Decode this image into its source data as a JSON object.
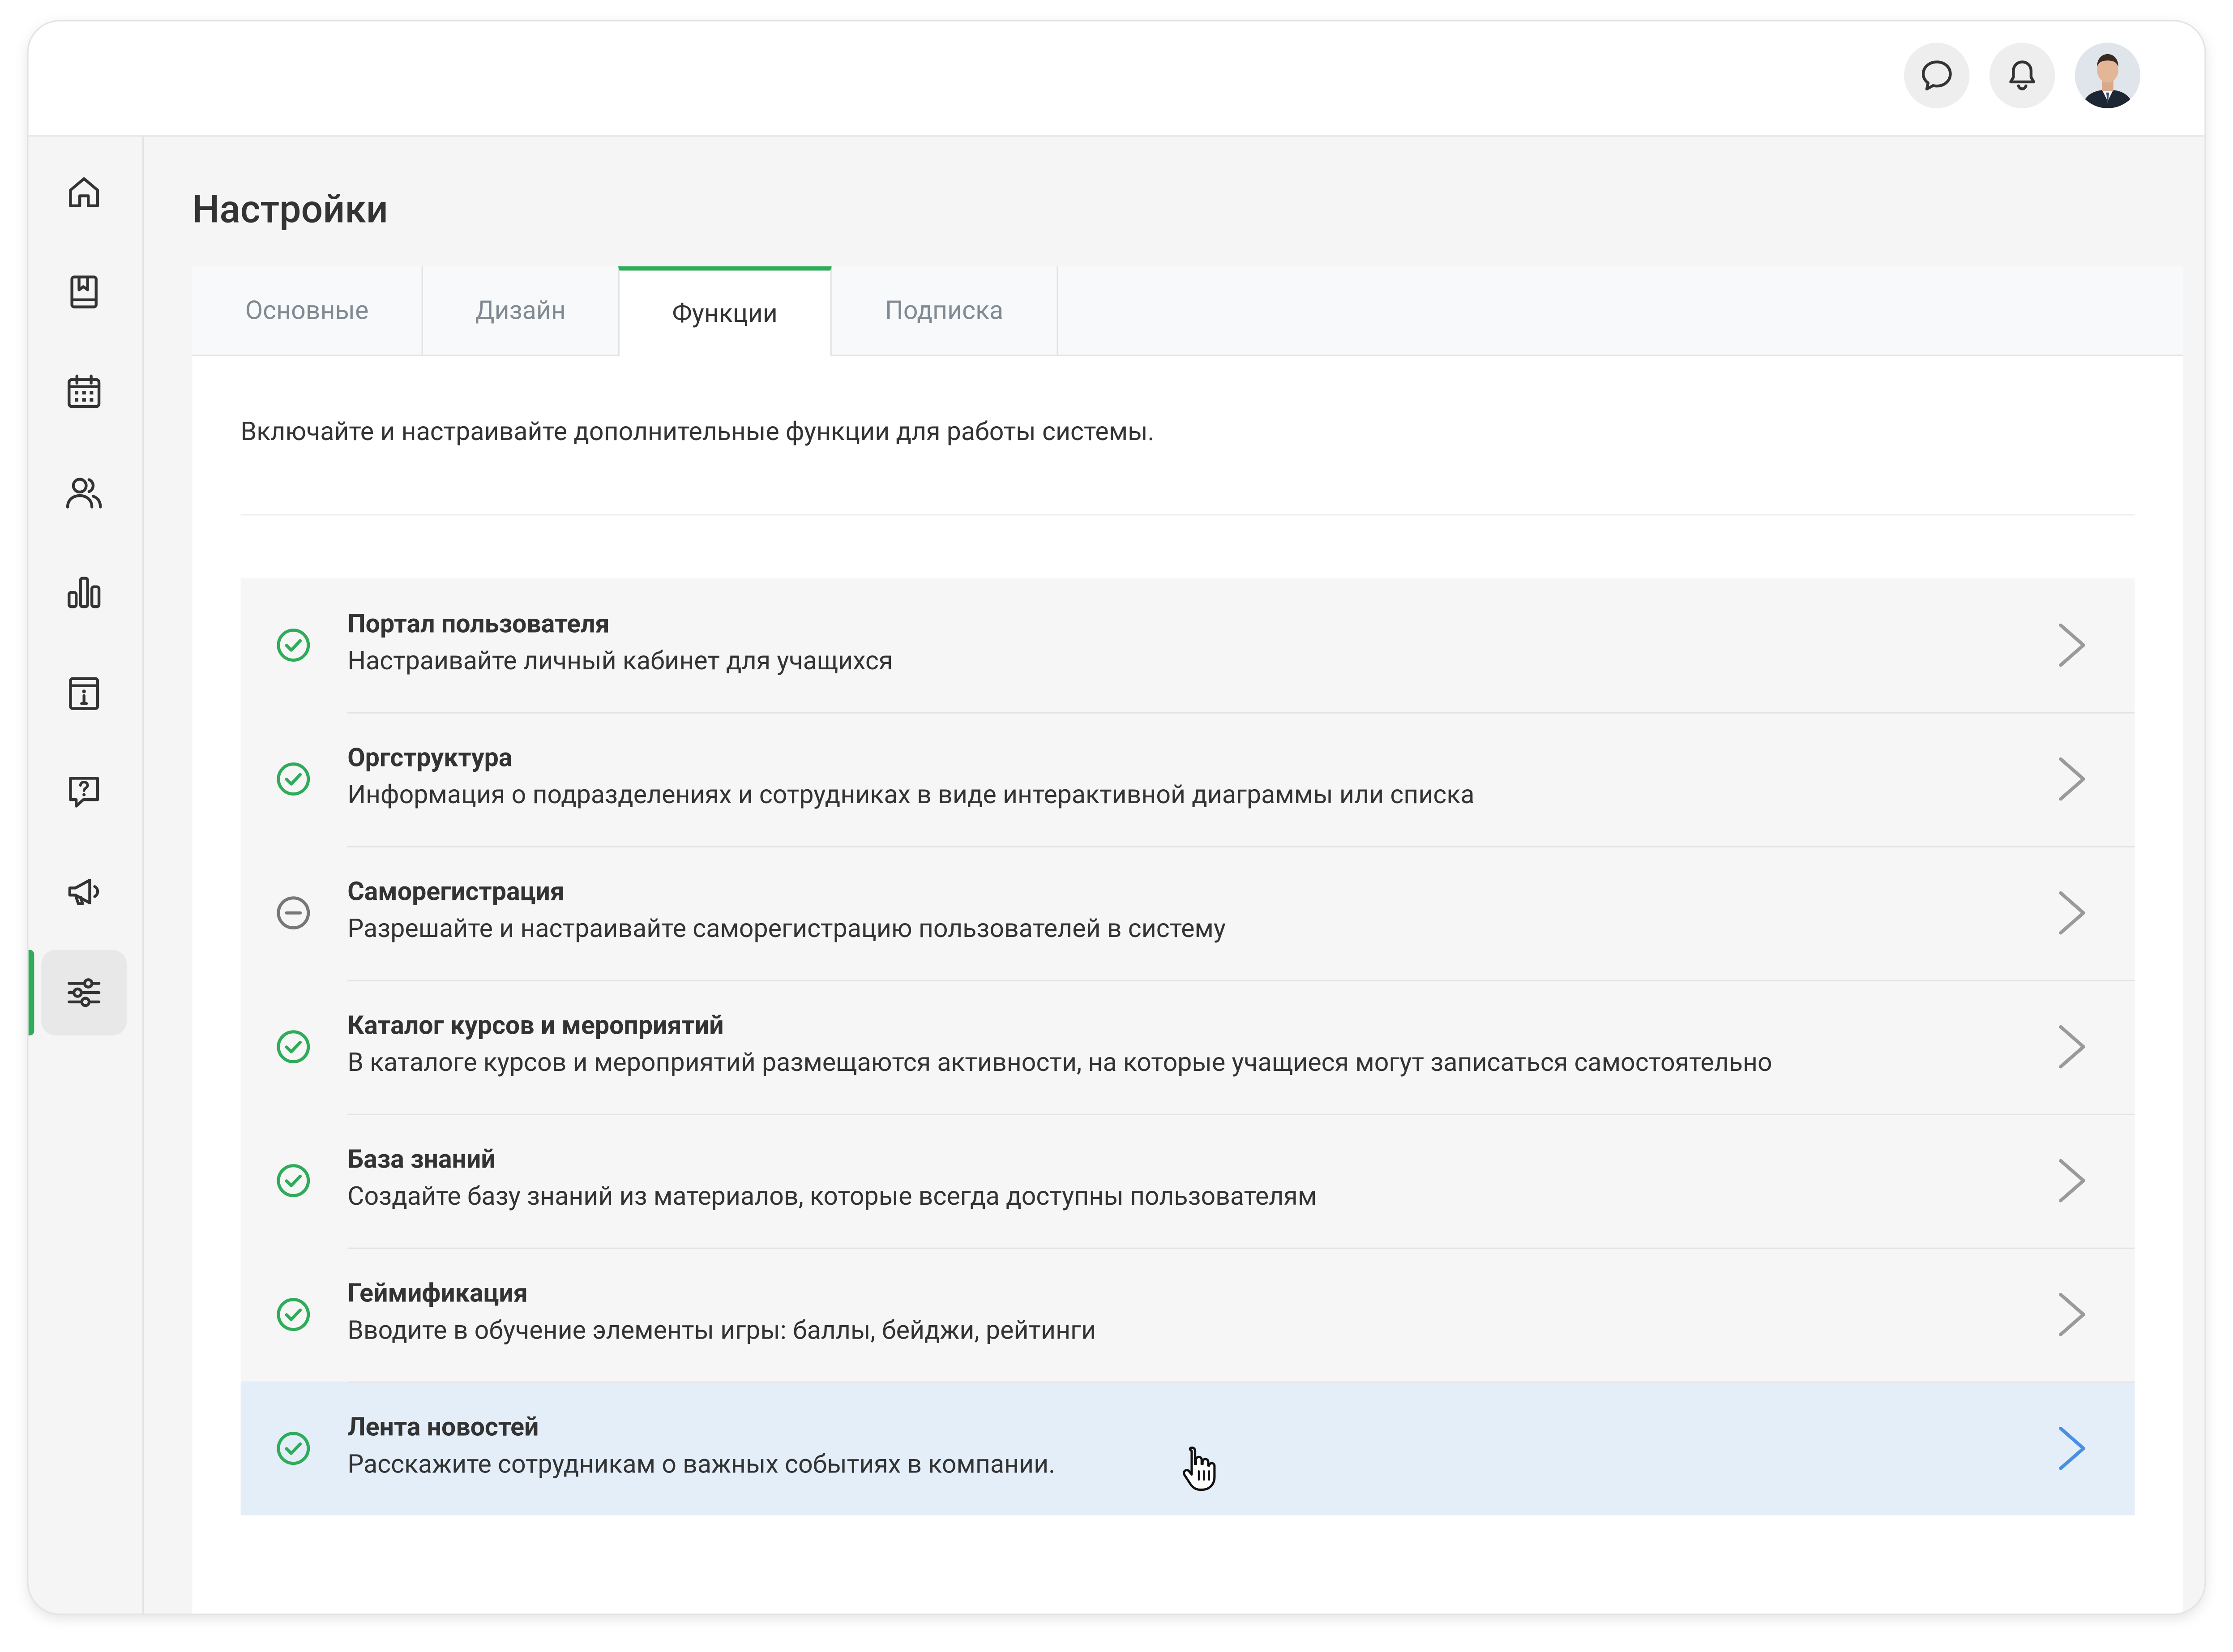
{
  "page": {
    "title": "Настройки",
    "intro": "Включайте и настраивайте дополнительные функции для работы системы."
  },
  "tabs": [
    {
      "label": "Основные",
      "active": false
    },
    {
      "label": "Дизайн",
      "active": false
    },
    {
      "label": "Функции",
      "active": true
    },
    {
      "label": "Подписка",
      "active": false
    }
  ],
  "header": {
    "icons": [
      "chat-icon",
      "bell-icon",
      "avatar"
    ]
  },
  "sidebar": {
    "items": [
      {
        "icon": "home-icon"
      },
      {
        "icon": "book-icon"
      },
      {
        "icon": "calendar-icon"
      },
      {
        "icon": "users-icon"
      },
      {
        "icon": "bar-chart-icon"
      },
      {
        "icon": "info-board-icon"
      },
      {
        "icon": "question-chat-icon"
      },
      {
        "icon": "megaphone-icon"
      },
      {
        "icon": "sliders-icon",
        "active": true
      }
    ]
  },
  "features": [
    {
      "title": "Портал пользователя",
      "description": "Настраивайте личный кабинет для учащихся",
      "status": "enabled"
    },
    {
      "title": "Оргструктура",
      "description": "Информация о подразделениях и сотрудниках в виде интерактивной диаграммы или списка",
      "status": "enabled"
    },
    {
      "title": "Саморегистрация",
      "description": "Разрешайте и настраивайте саморегистрацию пользователей в систему",
      "status": "disabled"
    },
    {
      "title": "Каталог курсов и мероприятий",
      "description": "В каталоге курсов и мероприятий размещаются активности, на которые учащиеся могут записаться самостоятельно",
      "status": "enabled"
    },
    {
      "title": "База знаний",
      "description": "Создайте базу знаний из материалов, которые всегда доступны пользователям",
      "status": "enabled"
    },
    {
      "title": "Геймификация",
      "description": "Вводите в обучение элементы игры: баллы, бейджи, рейтинги",
      "status": "enabled"
    },
    {
      "title": "Лента новостей",
      "description": "Расскажите сотрудникам о важных событиях в компании.",
      "status": "enabled",
      "hovered": true
    }
  ],
  "colors": {
    "accent": "#2fab59",
    "hover_row": "#e4eef9",
    "chevron_hover": "#4a90e2",
    "chevron": "#9a9a9a"
  }
}
